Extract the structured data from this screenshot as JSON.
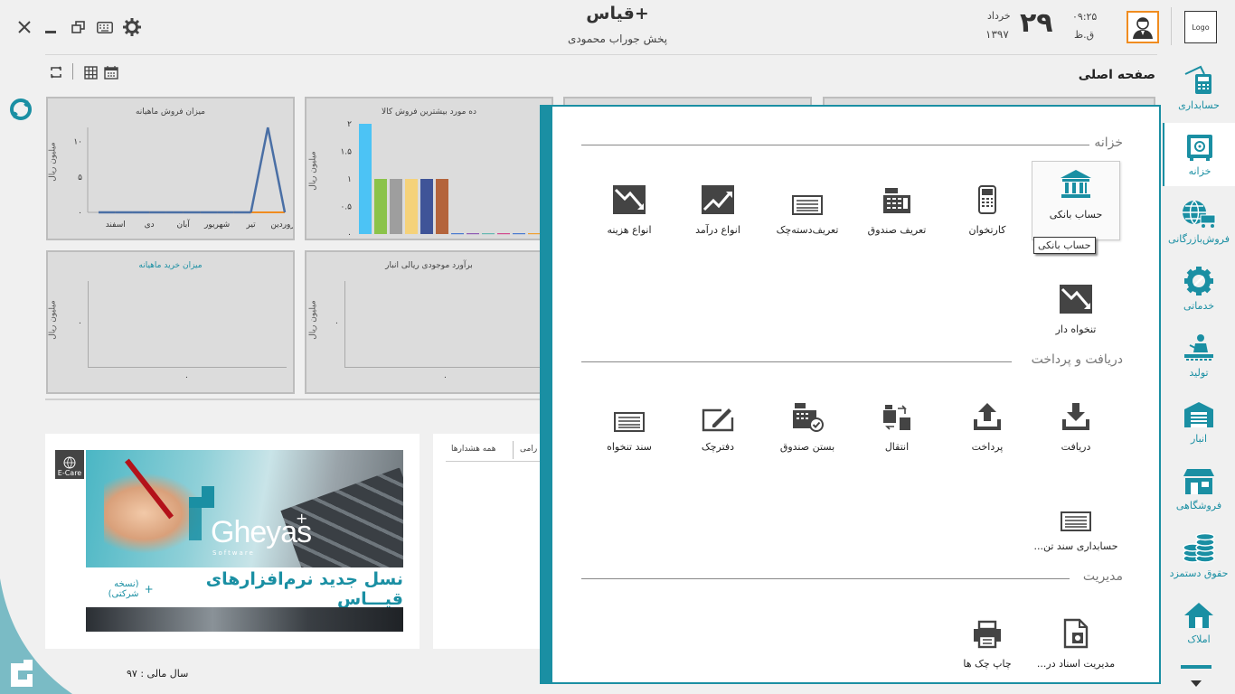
{
  "header": {
    "app_title": "قیاس+",
    "company": "پخش جوراب محمودی",
    "day": "۲۹",
    "month": "خرداد",
    "year": "۱۳۹۷",
    "time": "۰۹:۲۵",
    "ampm": "ق.ظ",
    "logo_text": "Logo"
  },
  "page": {
    "title": "صفحه اصلی",
    "fiscal_year": "سال مالی : ۹۷"
  },
  "sidebar": {
    "items": [
      {
        "label": "حسابداری"
      },
      {
        "label": "خزانه"
      },
      {
        "label": "فروش‌بازرگانی"
      },
      {
        "label": "خدماتی"
      },
      {
        "label": "تولید"
      },
      {
        "label": "انبار"
      },
      {
        "label": "فروشگاهی"
      },
      {
        "label": "حقوق دستمزد"
      },
      {
        "label": "املاک"
      }
    ]
  },
  "menu": {
    "sections": [
      {
        "title": "خزانه",
        "items": [
          "حساب بانکی",
          "کارتخوان",
          "تعریف صندوق",
          "تعریف‌دسته‌چک",
          "انواع درآمد",
          "انواع هزینه",
          "تنخواه دار"
        ]
      },
      {
        "title": "دریافت و پرداخت",
        "items": [
          "دریافت",
          "پرداخت",
          "انتقال",
          "بستن صندوق",
          "دفترچک",
          "سند تنخواه",
          "حسابداری سند تن..."
        ]
      },
      {
        "title": "مدیریت",
        "items": [
          "مدیریت اسناد در...",
          "چاپ چک ها"
        ]
      }
    ],
    "tooltip": "حساب بانکی"
  },
  "dashboard": {
    "chart1": {
      "title": "میزان فروش ماهیانه",
      "ylabel": "میلیون ریال"
    },
    "chart2": {
      "title": "ده مورد بیشترین فروش کالا",
      "ylabel": "میلیون ریال"
    },
    "chart3": {
      "title": "میزان خرید ماهیانه",
      "ylabel": "میلیون ریال",
      "x_tick": "۰",
      "y_tick": "۰"
    },
    "chart4": {
      "title": "برآورد موجودی ریالی انبار",
      "ylabel": "میلیون ریال",
      "x_tick": "۰",
      "y_tick": "۰"
    }
  },
  "chart_data": [
    {
      "type": "line",
      "title": "میزان فروش ماهیانه",
      "ylabel": "میلیون ریال",
      "x": [
        "فروردین",
        "تیر",
        "شهریور",
        "آبان",
        "دی",
        "اسفند"
      ],
      "y_ticks": [
        "۰",
        "۵",
        "۱۰"
      ],
      "ylim": [
        0,
        12
      ],
      "series": [
        {
          "values": [
            0,
            12,
            0,
            0,
            0,
            0,
            0,
            0,
            0,
            0,
            0,
            0
          ],
          "color": "#4a6fa5"
        }
      ]
    },
    {
      "type": "bar",
      "title": "ده مورد بیشترین فروش کالا",
      "ylabel": "میلیون ریال",
      "y_ticks": [
        "۰",
        "۰.۵",
        "۱",
        "۱.۵",
        "۲"
      ],
      "ylim": [
        0,
        2
      ],
      "values": [
        2,
        1,
        1,
        1,
        1,
        1,
        0,
        0,
        0,
        0,
        0,
        0
      ],
      "colors": [
        "#4cc3f5",
        "#8bc34a",
        "#9e9e9e",
        "#f5d27a",
        "#3f5498",
        "#b4643c",
        "#4a7bd0",
        "#8e5cb4",
        "#66b8b2",
        "#d24a8e",
        "#4a7bd0",
        "#f0a030"
      ]
    }
  ],
  "banner": {
    "badge": "E-Care",
    "brand": "Gheyas",
    "brand_sub": "Software",
    "slogan": "نسل جدید نرم‌افزارهای قیـــاس",
    "slogan_note": "(نسخه شرکتی)"
  },
  "alerts": {
    "tab1": "همه هشدارها",
    "tab2": "رامی"
  }
}
